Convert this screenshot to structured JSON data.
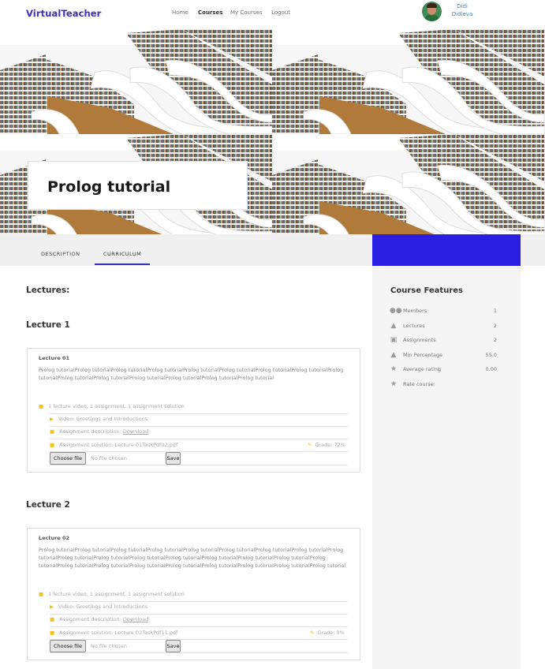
{
  "brand": "VirtualTeacher",
  "nav": [
    {
      "label": "Home",
      "active": false
    },
    {
      "label": "Courses",
      "active": true
    },
    {
      "label": "My Courses",
      "active": false
    },
    {
      "label": "Logout",
      "active": false
    }
  ],
  "user": {
    "first": "Didi",
    "last": "Didieva"
  },
  "course": {
    "title": "Prolog tutorial"
  },
  "tabs": [
    {
      "label": "DESCRIPTION",
      "active": false
    },
    {
      "label": "CURRICULUM",
      "active": true
    }
  ],
  "colors": {
    "accent": "#3b2dbd",
    "banner": "#2a1fe0",
    "link": "#2a8be6",
    "folder": "#f0c419"
  },
  "sidebar": {
    "title": "Course Features",
    "features": [
      {
        "icon": "members-icon",
        "label": "Members",
        "value": "1"
      },
      {
        "icon": "bell-icon",
        "label": "Lectures",
        "value": "2"
      },
      {
        "icon": "clipboard-icon",
        "label": "Assignments",
        "value": "2"
      },
      {
        "icon": "thumbs-up-icon",
        "label": "Min Percentage",
        "value": "55.0"
      },
      {
        "icon": "star-icon",
        "label": "Average rating",
        "value": "0.00"
      },
      {
        "icon": "star-icon",
        "label": "Rate course:",
        "value": ""
      }
    ]
  },
  "lectures_heading": "Lectures:",
  "lectures": [
    {
      "heading": "Lecture 1",
      "card_title": "Lecture 01",
      "description": "Prolog tutorialProlog tutorialProlog tutorialProlog tutorialProlog tutorialProlog tutorialProlog tutorialProlog tutorialProlog tutorialProlog tutorialProlog tutorialProlog tutorialProlog tutorialProlog tutorialProlog tutorial",
      "summary": "1 lecture video, 1 assignment, 1 assignment solution",
      "video": "Video: Greetings and Introductions",
      "assignment_label": "Assignment description:",
      "assignment_link": "Download",
      "solution": "Assignment solution: Lecture 01TaskPdf02.pdf",
      "grade": "Grade: 72%",
      "choose_file": "Choose file",
      "no_file": "No file chosen",
      "save": "Save"
    },
    {
      "heading": "Lecture 2",
      "card_title": "Lecture 02",
      "description": "Prolog tutorialProlog tutorialProlog tutorialProlog tutorialProlog tutorialProlog tutorialProlog tutorialProlog tutorialProlog tutorialProlog tutorialProlog tutorialProlog tutorialProlog tutorialProlog tutorialProlog tutorialProlog tutorialProlog tutorialProlog tutorialProlog tutorialProlog tutorialProlog tutorialProlog tutorialProlog tutorialProlog tutorialProlog tutorial",
      "summary": "1 lecture video, 1 assignment, 1 assignment solution",
      "video": "Video: Greetings and Introductions",
      "assignment_label": "Assignment description:",
      "assignment_link": "Download",
      "solution": "Assignment solution: Lecture 02TaskPdf11.pdf",
      "grade": "Grade: 0%",
      "choose_file": "Choose file",
      "no_file": "No file chosen",
      "save": "Save"
    }
  ]
}
